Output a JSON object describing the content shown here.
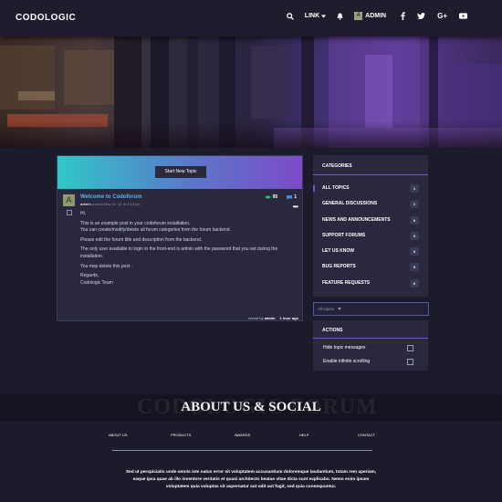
{
  "header": {
    "logo": "CODOLOGIC",
    "nav": {
      "link_label": "LINK",
      "avatar_letter": "A",
      "user_label": "ADMIN"
    }
  },
  "main": {
    "start_button": "Start New Topic",
    "post": {
      "avatar_letter": "A",
      "title": "Welcome to Codoforum",
      "author": "admin",
      "posted": "posted May 31 '14 at 4:15 pm",
      "votes_up": "95",
      "votes_reply": "1",
      "body": [
        "Hi,",
        "This is an example post in your codoforum installation.",
        "You can create/modify/delete all forum categories from the forum backend.",
        "Please edit the forum title and description from the backend.",
        "The only user available to login in the front-end is admin with the password that you set during the installation.",
        "You may delete this post .",
        "Regards,",
        "Codologic Team"
      ],
      "footer_prefix": "recent by",
      "footer_user": "admin",
      "footer_time": "1 hour ago"
    }
  },
  "sidebar": {
    "categories_title": "CATEGORIES",
    "categories": [
      {
        "label": "ALL TOPICS",
        "count": "1"
      },
      {
        "label": "GENERAL DISCUSSIONS",
        "count": "1"
      },
      {
        "label": "NEWS AND ANNOUNCEMENTS",
        "count": "0"
      },
      {
        "label": "SUPPORT FORUMS",
        "count": "0"
      },
      {
        "label": "LET US KNOW",
        "count": "0"
      },
      {
        "label": "BUG REPORTS",
        "count": "0"
      },
      {
        "label": "FEATURE REQUESTS",
        "count": "0"
      }
    ],
    "topics_select": "All topics",
    "actions_title": "ACTIONS",
    "actions": [
      "Hide topic messages",
      "Enable infinite scrolling"
    ]
  },
  "about": {
    "title": "ABOUT US & SOCIAL",
    "ghost": "CODOLOGIC FORUM"
  },
  "footer": {
    "nav": [
      "ABOUT US",
      "PRODUCTS",
      "AWARDS",
      "HELP",
      "CONTACT"
    ],
    "text": "Sed ut perspiciatis unde omnis iste natus error sit voluptatem accusantium doloremque laudantium, totam rem aperiam, eaque ipsa quae ab illo inventore veritatis et quasi architecto beatae vitae dicta sunt explicabo. Nemo enim ipsam voluptatem quia voluptas sit aspernatur aut odit aut fugit, sed quia consequuntur."
  },
  "colors": {
    "accent": "#6a5ac8",
    "link": "#5fb2e8",
    "gradient_start": "#2fc7c9",
    "gradient_end": "#7b4bc6"
  }
}
